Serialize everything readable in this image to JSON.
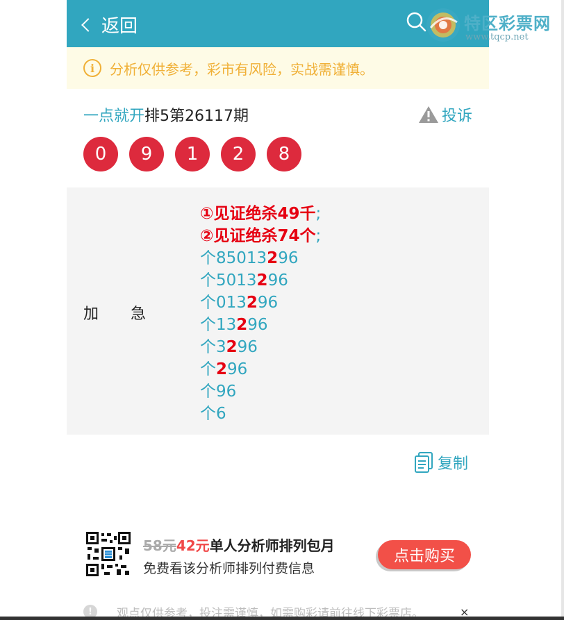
{
  "header": {
    "back_label": "返回"
  },
  "watermark": {
    "name": "特区彩票网",
    "url": "www.tqcp.net"
  },
  "notice": {
    "icon_char": "i",
    "text": "分析仅供参考，彩市有风险，实战需谨慎。"
  },
  "article": {
    "analyst": "一点就开",
    "issue": "排5第26117期",
    "complain_label": "投诉"
  },
  "balls": [
    "0",
    "9",
    "1",
    "2",
    "8"
  ],
  "ball_color": "#dd2a3d",
  "content": {
    "label": "加急",
    "lines": [
      {
        "type": "headline",
        "text": "①见证绝杀49千",
        "suffix": ";"
      },
      {
        "type": "headline",
        "text": "②见证绝杀74个",
        "suffix": ";"
      },
      {
        "type": "code",
        "pre": "个85013",
        "hl": "2",
        "post": "96"
      },
      {
        "type": "code",
        "pre": "个5013",
        "hl": "2",
        "post": "96"
      },
      {
        "type": "code",
        "pre": "个013",
        "hl": "2",
        "post": "96"
      },
      {
        "type": "code",
        "pre": "个13",
        "hl": "2",
        "post": "96"
      },
      {
        "type": "code",
        "pre": "个3",
        "hl": "2",
        "post": "96"
      },
      {
        "type": "code",
        "pre": "个",
        "hl": "2",
        "post": "96"
      },
      {
        "type": "code",
        "pre": "个96",
        "hl": "",
        "post": ""
      },
      {
        "type": "code",
        "pre": "个6",
        "hl": "",
        "post": ""
      }
    ]
  },
  "copy_label": "复制",
  "promo": {
    "old_price": "58元",
    "new_price": "42元",
    "title": "单人分析师排列包月",
    "subtitle": "免费看该分析师排列付费信息",
    "buy_label": "点击购买"
  },
  "footer": {
    "tip": "观点仅供参考，投注需谨慎，如需购彩请前往线下彩票店。",
    "close": "×"
  },
  "colors": {
    "header": "#31a6bf",
    "accent_text": "#31a6bf",
    "highlight_red": "#e60012",
    "notice_bg": "#fefbe6",
    "notice_text": "#f0b037",
    "buy_button": "#f25048",
    "content_bg": "#f4f4f4"
  }
}
